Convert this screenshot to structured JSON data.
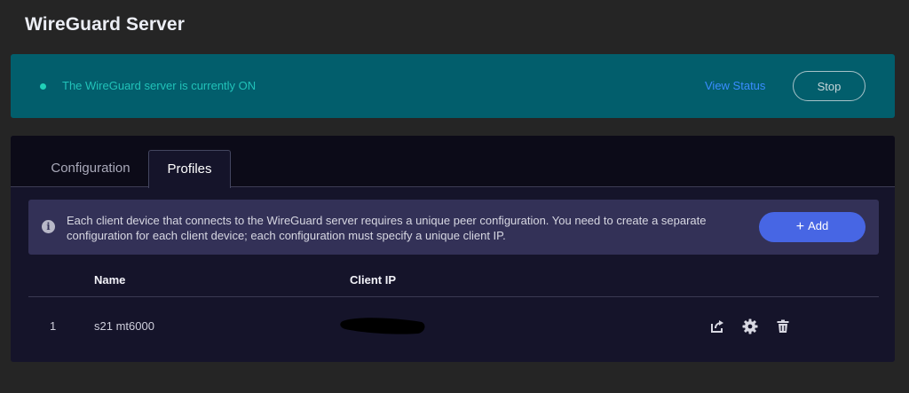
{
  "header": {
    "title": "WireGuard Server"
  },
  "status": {
    "message": "The WireGuard server is currently ON",
    "view_status_label": "View Status",
    "stop_label": "Stop",
    "indicator_color": "#20d0b8"
  },
  "tabs": [
    {
      "label": "Configuration",
      "active": false
    },
    {
      "label": "Profiles",
      "active": true
    }
  ],
  "info": {
    "icon": "info-icon",
    "text": "Each client device that connects to the WireGuard server requires a unique peer configuration. You need to create a separate configuration for each client device; each configuration must specify a unique client IP.",
    "add_label": "Add"
  },
  "table": {
    "columns": [
      "Name",
      "Client IP"
    ],
    "rows": [
      {
        "index": "1",
        "name": "s21 mt6000",
        "client_ip": ""
      }
    ]
  },
  "row_actions": [
    "export-icon",
    "gear-icon",
    "trash-icon"
  ],
  "colors": {
    "background": "#252525",
    "banner": "#025e6c",
    "accent_link": "#3a8dff",
    "add_button": "#4766e4",
    "panel": "#15142a"
  }
}
